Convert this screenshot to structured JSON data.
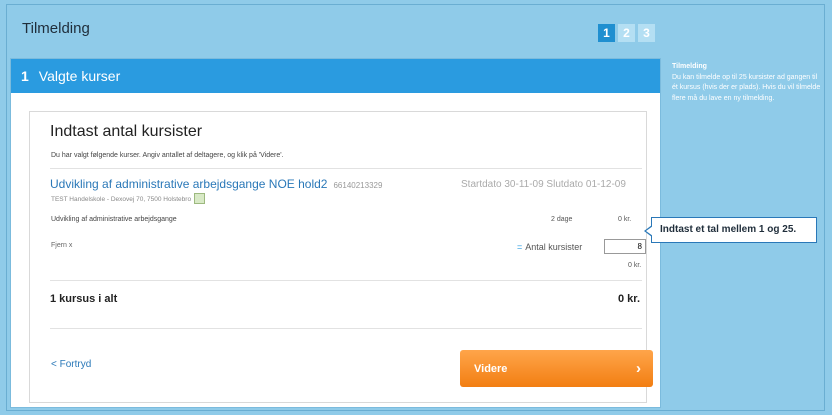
{
  "header": {
    "title": "Tilmelding",
    "steps": [
      "1",
      "2",
      "3"
    ]
  },
  "panel": {
    "step_number": "1",
    "title": "Valgte kurser"
  },
  "form": {
    "heading": "Indtast antal kursister",
    "instruction": "Du har valgt følgende kurser. Angiv antallet af deltagere, og klik på 'Videre'.",
    "course": {
      "title": "Udvikling af administrative arbejdsgange NOE hold2",
      "code": "66140213329",
      "dates": "Startdato 30-11-09 Slutdato 01-12-09",
      "location": "TEST Handelskole - Dexovej 70, 7500 Holstebro",
      "line_description": "Udvikling af administrative arbejdsgange",
      "line_days": "2 dage",
      "line_price": "0 kr."
    },
    "remove_label": "Fjern x",
    "count_label": "Antal kursister",
    "count_marker": "=",
    "count_value": "8",
    "subtotal": "0 kr.",
    "total_label": "1 kursus i alt",
    "total_value": "0 kr."
  },
  "nav": {
    "back_label": "< Fortryd",
    "next_label": "Videre",
    "next_chevron": "›"
  },
  "tooltip": {
    "text": "Indtast et tal mellem 1 og 25."
  },
  "help": {
    "title": "Tilmelding",
    "body": "Du kan tilmelde op til 25 kursister ad gangen til ét kursus (hvis der er plads). Hvis du vil tilmelde flere må du lave en ny tilmelding."
  },
  "colors": {
    "background": "#8fcbe9",
    "header_bar": "#2a9be0",
    "step_active": "#1f8fd0",
    "link": "#2a78b8",
    "button": "#f27e12"
  }
}
